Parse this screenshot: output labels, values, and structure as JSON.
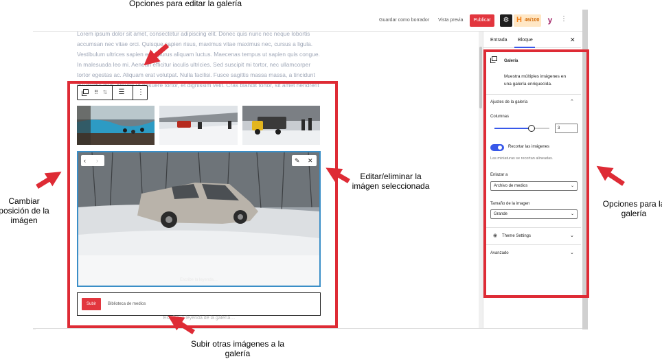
{
  "annotations": {
    "top": "Opciones para editar la galería",
    "left": "Cambiar posición de la imágen",
    "right": "Editar/eliminar la imágen seleccionada",
    "bottom": "Subir otras imágenes a la galería",
    "sidebar": "Opciones para la galería"
  },
  "topbar": {
    "save_draft": "Guardar como borrador",
    "preview": "Vista previa",
    "publish": "Publicar",
    "seo_score": "46/100"
  },
  "editor": {
    "paragraph": "Lorem ipsum dolor sit amet, consectetur adipiscing elit. Donec quis nunc nec neque lobortis accumsan nec vitae orci. Quisque sapien risus, maximus vitae maximus nec, cursus a ligula. Vestibulum ultrices sapien eget purus aliquam luctus. Maecenas tempus ut sapien quis congue. In malesuada leo mi. Aenean efficitur iaculis ultricies. Sed suscipit mi tortor, nec ullamcorper tortor egestas ac. Aliquam erat volutpat. Nulla facilisi. Fusce sagittis massa massa, a tincidunt dui mattis quis. Mauris ut posuere tortor, et dignissim velit. Cras blandit tortor, sit amet hendrerit velit.",
    "image_caption_placeholder": "Escribe la leyenda…",
    "upload_button": "Subir",
    "media_library": "Biblioteca de medios",
    "gallery_caption_placeholder": "Escribe la leyenda de la galería…"
  },
  "sidebar": {
    "tabs": [
      "Entrada",
      "Bloque"
    ],
    "active_tab": "Bloque",
    "block_title": "Galería",
    "block_description": "Muestra múltiples imágenes en una galería enriquecida.",
    "settings_title": "Ajustes de la galería",
    "columns_label": "Columnas",
    "columns_value": "3",
    "columns_slider_fraction": 0.67,
    "crop_label": "Recortar las imágenes",
    "crop_enabled": true,
    "crop_help": "Las miniaturas se recortan alineadas.",
    "link_label": "Enlazar a",
    "link_value": "Archivo de medios",
    "size_label": "Tamaño de la imagen",
    "size_value": "Grande",
    "theme_settings": "Theme Settings",
    "advanced": "Avanzado"
  },
  "colors": {
    "accent": "#3858e9",
    "publish": "#e2363e",
    "annotation": "#de2b35"
  }
}
